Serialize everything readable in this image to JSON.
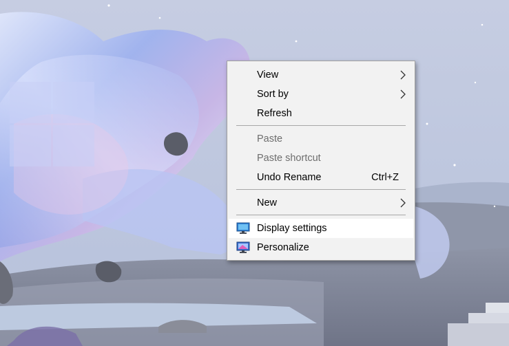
{
  "context_menu": {
    "items": [
      {
        "label": "View",
        "submenu": true
      },
      {
        "label": "Sort by",
        "submenu": true
      },
      {
        "label": "Refresh"
      },
      {
        "label": "Paste",
        "disabled": true
      },
      {
        "label": "Paste shortcut",
        "disabled": true
      },
      {
        "label": "Undo Rename",
        "shortcut": "Ctrl+Z"
      },
      {
        "label": "New",
        "submenu": true
      },
      {
        "label": "Display settings",
        "icon": "display-icon",
        "highlighted": true
      },
      {
        "label": "Personalize",
        "icon": "personalize-icon"
      }
    ]
  },
  "colors": {
    "menu_bg": "#f2f2f2",
    "highlight_bg": "#ffffff",
    "disabled_text": "#6d6d6d",
    "separator": "#a7a7a7"
  }
}
